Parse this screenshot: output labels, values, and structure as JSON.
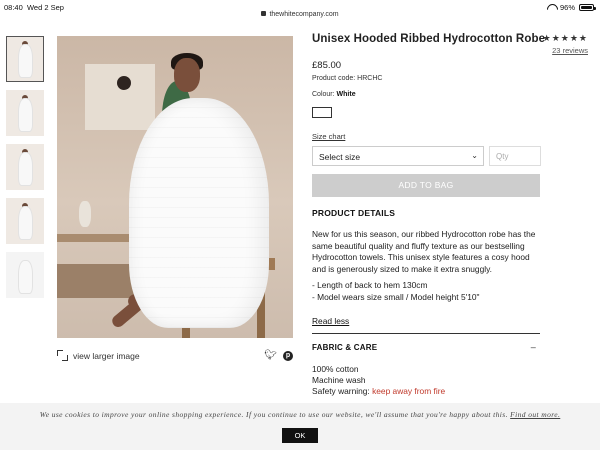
{
  "status_bar": {
    "time": "08:40",
    "date": "Wed 2 Sep",
    "url": "thewhitecompany.com",
    "battery": "96%"
  },
  "gallery": {
    "thumbnails": [
      "thumbnail-1",
      "thumbnail-2",
      "thumbnail-3",
      "thumbnail-4",
      "thumbnail-5"
    ],
    "active_index": 0,
    "view_larger_label": "view larger image",
    "icons": [
      "expand-icon",
      "twitter-icon",
      "pinterest-icon"
    ]
  },
  "product": {
    "title": "Unisex Hooded Ribbed Hydrocotton Robe",
    "stars": "★★★★★",
    "rating_fraction": 1.0,
    "reviews_label": "23 reviews",
    "price": "£85.00",
    "code_label": "Product code:",
    "code_value": "HRCHC",
    "colour_label": "Colour:",
    "colour_value": "White",
    "swatch_color": "#ffffff",
    "size_chart_label": "Size chart",
    "size_select_value": "Select size",
    "qty_placeholder": "Qty",
    "add_to_bag_label": "ADD TO BAG",
    "add_to_bag_color": "#cdcdcd"
  },
  "details": {
    "heading": "PRODUCT DETAILS",
    "description": "New for us this season, our ribbed Hydrocotton robe has the same beautiful quality and fluffy texture as our bestselling Hydrocotton towels. This unisex style features a cosy hood and is generously sized to make it extra snuggly.",
    "bullets": [
      "- Length of back to hem 130cm",
      "- Model wears size small / Model height 5'10\""
    ],
    "read_less_label": "Read less"
  },
  "fabric": {
    "heading": "FABRIC & CARE",
    "toggle": "–",
    "lines": [
      "100% cotton",
      "Machine wash"
    ],
    "warning_label": "Safety warning: ",
    "warning_text": "keep away from fire",
    "warning_color": "#c0392b"
  },
  "cookie": {
    "message": "We use cookies to improve your online shopping experience. If you continue to use our website, we'll assume that you're happy about this. ",
    "link_label": "Find out more.",
    "ok_label": "OK"
  }
}
